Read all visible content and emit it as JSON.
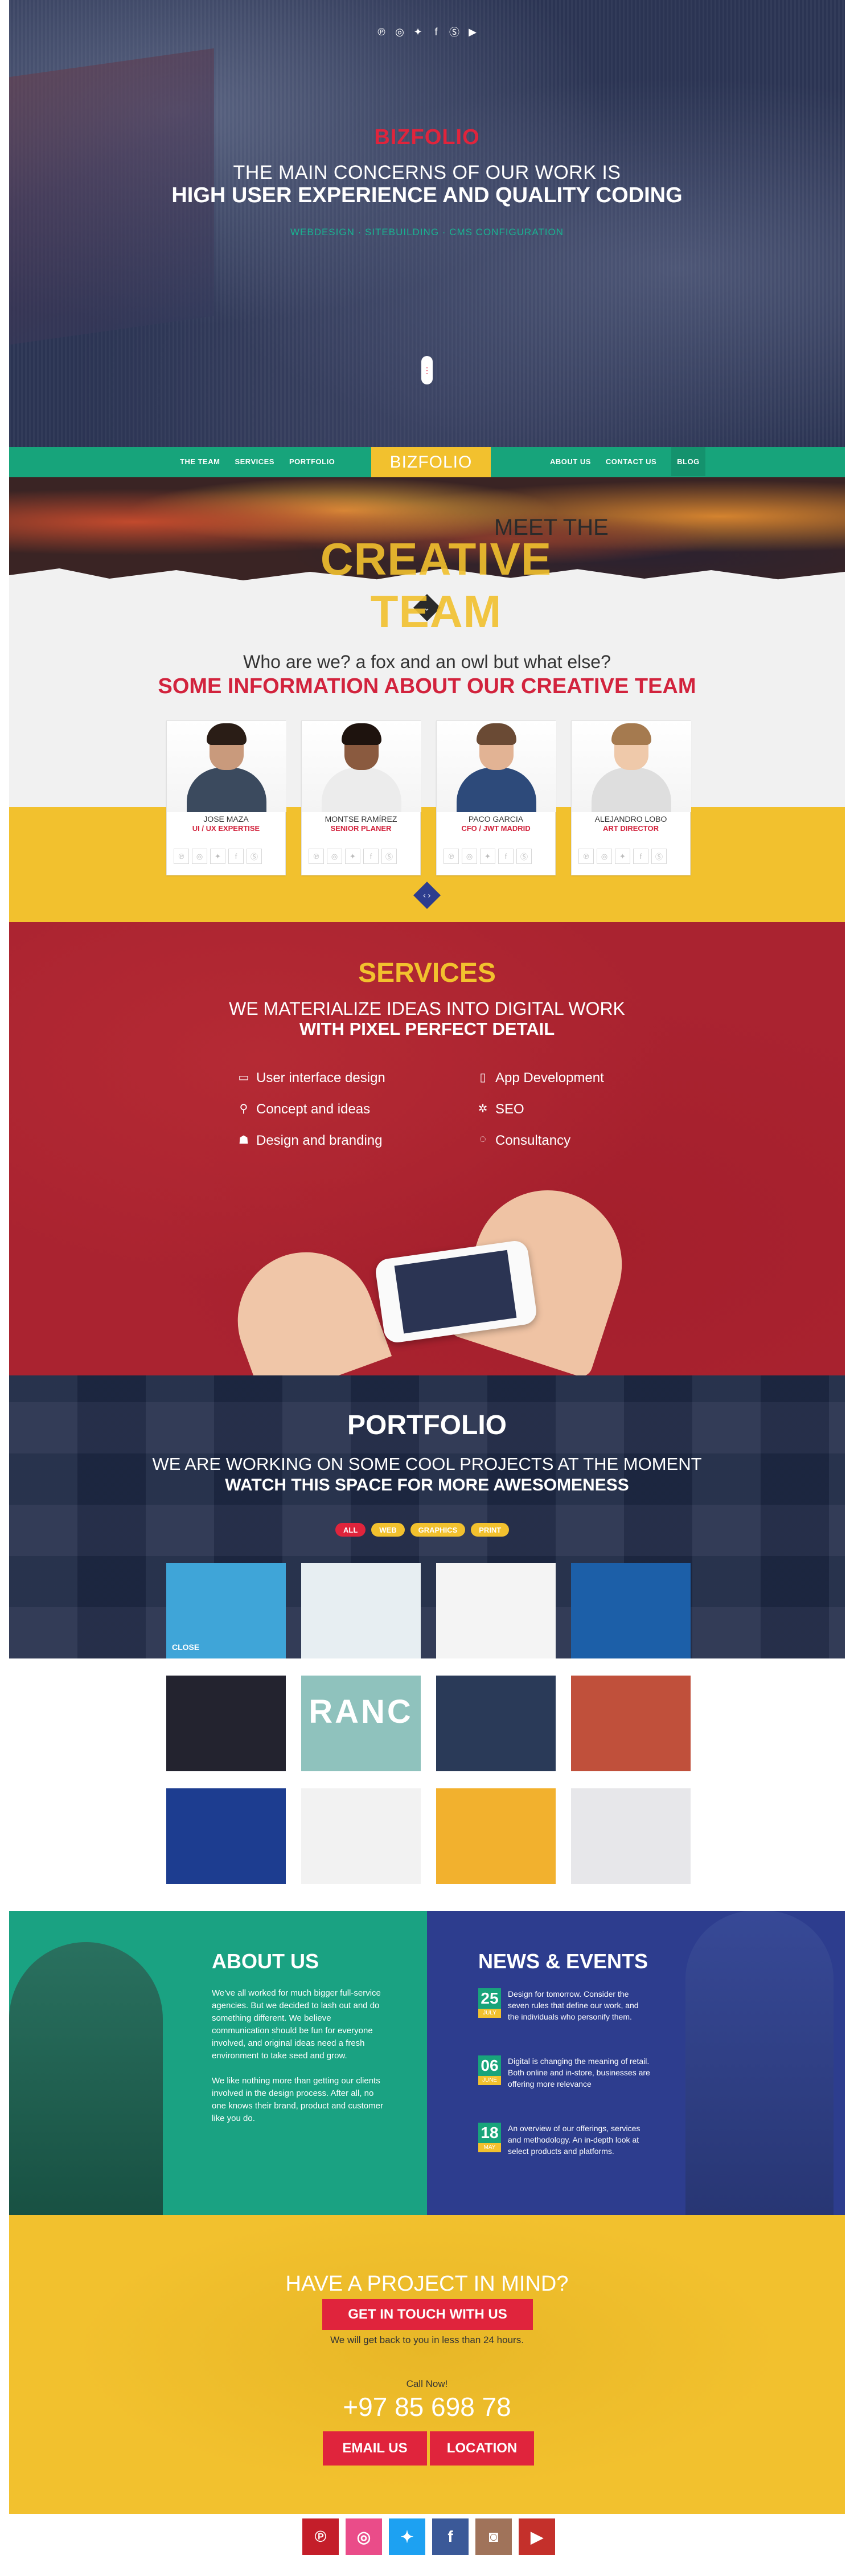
{
  "hero": {
    "social_icons": [
      "pinterest-icon",
      "dribbble-icon",
      "twitter-icon",
      "facebook-icon",
      "skype-icon",
      "youtube-icon"
    ],
    "social_glyphs": [
      "℗",
      "◎",
      "✦",
      "f",
      "Ⓢ",
      "▶"
    ],
    "logo": "BIZFOLIO",
    "line1": "THE MAIN CONCERNS OF OUR WORK IS",
    "line2": "HIGH USER EXPERIENCE AND QUALITY CODING",
    "tags": "WEBDESIGN · SITEBUILDING · CMS CONFIGURATION",
    "scroll_glyph": "⋮"
  },
  "nav": {
    "left": [
      "THE TEAM",
      "SERVICES",
      "PORTFOLIO"
    ],
    "logo": "BIZFOLIO",
    "right": [
      "ABOUT US",
      "CONTACT US",
      "BLOG"
    ]
  },
  "team_banner": {
    "meet": "MEET THE",
    "creative": "CREATIVE TEAM"
  },
  "who": {
    "question": "Who are we? a fox and an owl but what else?",
    "title": "SOME INFORMATION ABOUT OUR CREATIVE TEAM",
    "down_glyph": "⌄",
    "nav_glyph": "‹ ›"
  },
  "team": [
    {
      "name": "JOSE MAZA",
      "role": "UI / UX EXPERTISE",
      "skin": "#c99a7c",
      "hair": "#2a1d16",
      "shirt": "#3b4a5e"
    },
    {
      "name": "MONTSE RAMÍREZ",
      "role": "SENIOR PLANER",
      "skin": "#8a5a3f",
      "hair": "#1e130e",
      "shirt": "#ececec"
    },
    {
      "name": "PACO GARCIA",
      "role": "CFO / JWT MADRID",
      "skin": "#e2b394",
      "hair": "#6a4a34",
      "shirt": "#2d4a7a"
    },
    {
      "name": "ALEJANDRO LOBO",
      "role": "ART DIRECTOR",
      "skin": "#efc9aa",
      "hair": "#a57a4f",
      "shirt": "#dedede"
    }
  ],
  "card_icons": [
    "℗",
    "◎",
    "✦",
    "f",
    "Ⓢ"
  ],
  "services": {
    "title": "SERVICES",
    "line1": "WE MATERIALIZE IDEAS INTO DIGITAL WORK",
    "line2": "WITH PIXEL PERFECT DETAIL",
    "left": [
      {
        "icon": "▭",
        "label": "User interface design"
      },
      {
        "icon": "⚲",
        "label": "Concept and ideas"
      },
      {
        "icon": "☗",
        "label": "Design and branding"
      }
    ],
    "right": [
      {
        "icon": "▯",
        "label": "App Development"
      },
      {
        "icon": "✲",
        "label": "SEO"
      },
      {
        "icon": "◌",
        "label": "Consultancy"
      }
    ]
  },
  "portfolio": {
    "title": "PORTFOLIO",
    "line1": "WE ARE WORKING ON SOME COOL PROJECTS AT THE MOMENT",
    "line2": "WATCH THIS SPACE FOR MORE AWESOMENESS",
    "filters": [
      {
        "label": "ALL",
        "color": "#e0243c"
      },
      {
        "label": "WEB",
        "color": "#f2c12e"
      },
      {
        "label": "GRAPHICS",
        "color": "#f2c12e"
      },
      {
        "label": "PRINT",
        "color": "#f2c12e"
      }
    ],
    "tiles": [
      {
        "name": "android-app-tile",
        "bg": "#3fa5d8",
        "label": "CLOSE"
      },
      {
        "name": "dashboard-tile",
        "bg": "#e7eef2",
        "label": ""
      },
      {
        "name": "camera-icon-tile",
        "bg": "#f4f4f4",
        "label": ""
      },
      {
        "name": "speed-app-tile",
        "bg": "#1c5fa8",
        "label": ""
      },
      {
        "name": "product-ui-tile",
        "bg": "#23232f",
        "label": ""
      },
      {
        "name": "ranc-brand-tile",
        "bg": "#8fc2bd",
        "label": "RANC"
      },
      {
        "name": "mobile-app-tile",
        "bg": "#2a3a58",
        "label": ""
      },
      {
        "name": "phone-hand-tile",
        "bg": "#c0503b",
        "label": ""
      },
      {
        "name": "blue-web-tile",
        "bg": "#1d3d90",
        "label": ""
      },
      {
        "name": "blog-web-tile",
        "bg": "#f2f2f2",
        "label": ""
      },
      {
        "name": "stationery-tile",
        "bg": "#f2b12e",
        "label": ""
      },
      {
        "name": "red-app-icon-tile",
        "bg": "#e7e7ea",
        "label": ""
      }
    ]
  },
  "about": {
    "title": "ABOUT US",
    "p1": "We've all worked for much bigger full-service agencies. But we decided to lash out and do something different. We believe communication should be fun for everyone involved, and original ideas need a fresh environment to take seed and grow.",
    "p2": "We like nothing more than getting our clients involved in the design process. After all, no one knows their brand, product and customer like you do."
  },
  "news": {
    "title": "NEWS & EVENTS",
    "items": [
      {
        "day": "25",
        "month": "JULY",
        "text": "Design for tomorrow. Consider the seven rules that define our work, and the individuals who personify them."
      },
      {
        "day": "06",
        "month": "JUNE",
        "text": "Digital is changing the meaning of retail. Both online and in-store, businesses are offering more relevance"
      },
      {
        "day": "18",
        "month": "MAY",
        "text": "An overview of our offerings, services and methodology. An in-depth look at select products and platforms."
      }
    ]
  },
  "contact": {
    "title": "HAVE A PROJECT IN MIND?",
    "cta": "GET IN TOUCH WITH US",
    "note": "We will get back to you in less than 24 hours.",
    "call": "Call Now!",
    "phone": "+97 85 698 78",
    "email_btn": "EMAIL US",
    "location_btn": "LOCATION"
  },
  "footer": {
    "social": [
      {
        "name": "pinterest-icon",
        "glyph": "℗",
        "color": "#c41e2a"
      },
      {
        "name": "dribbble-icon",
        "glyph": "◎",
        "color": "#ea4c89"
      },
      {
        "name": "twitter-icon",
        "glyph": "✦",
        "color": "#1da1f2"
      },
      {
        "name": "facebook-icon",
        "glyph": "f",
        "color": "#3b5998"
      },
      {
        "name": "instagram-icon",
        "glyph": "◙",
        "color": "#a0735a"
      },
      {
        "name": "youtube-icon",
        "glyph": "▶",
        "color": "#c4302b"
      }
    ]
  },
  "colors": {
    "red": "#e0243c",
    "yellow": "#f2c12e",
    "green": "#17a47b",
    "navy": "#2b3453"
  }
}
